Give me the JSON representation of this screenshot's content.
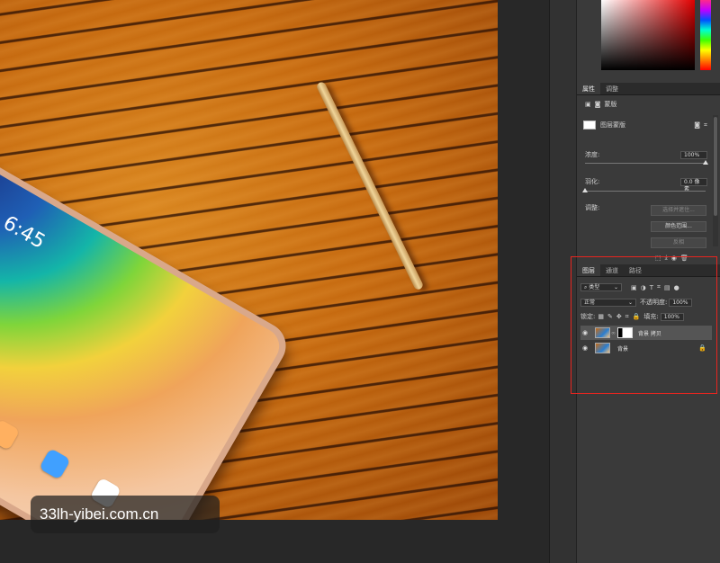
{
  "canvas": {
    "tablet_clock": "6:45",
    "watermark": "33lh-yibei.com.cn"
  },
  "properties_panel": {
    "tabs": [
      {
        "label": "属性",
        "active": true
      },
      {
        "label": "调整",
        "active": false
      }
    ],
    "mode_label": "蒙版",
    "mask_type_label": "图层蒙版",
    "density_label": "浓度:",
    "density_value": "100%",
    "density_fraction": 1.0,
    "feather_label": "羽化:",
    "feather_value": "0.0 像素",
    "feather_fraction": 0.0,
    "adjust_label": "调整:",
    "select_and_mask_button": "选择并遮住...",
    "color_range_button": "颜色范围...",
    "invert_button": "反相"
  },
  "layers_panel": {
    "tabs": [
      {
        "label": "图层",
        "active": true
      },
      {
        "label": "通道",
        "active": false
      },
      {
        "label": "路径",
        "active": false
      }
    ],
    "filter_label": "类型",
    "blend_mode": "正常",
    "opacity_label": "不透明度:",
    "opacity_value": "100%",
    "lock_label": "锁定:",
    "fill_label": "填充:",
    "fill_value": "100%",
    "layers": [
      {
        "name": "背景 拷贝",
        "visible": true,
        "selected": true,
        "has_mask": true,
        "locked": false
      },
      {
        "name": "背景",
        "visible": true,
        "selected": false,
        "has_mask": false,
        "locked": true
      }
    ]
  },
  "colors": {
    "highlight_box": "#e8251f",
    "panel_bg": "#3a3a3a"
  }
}
